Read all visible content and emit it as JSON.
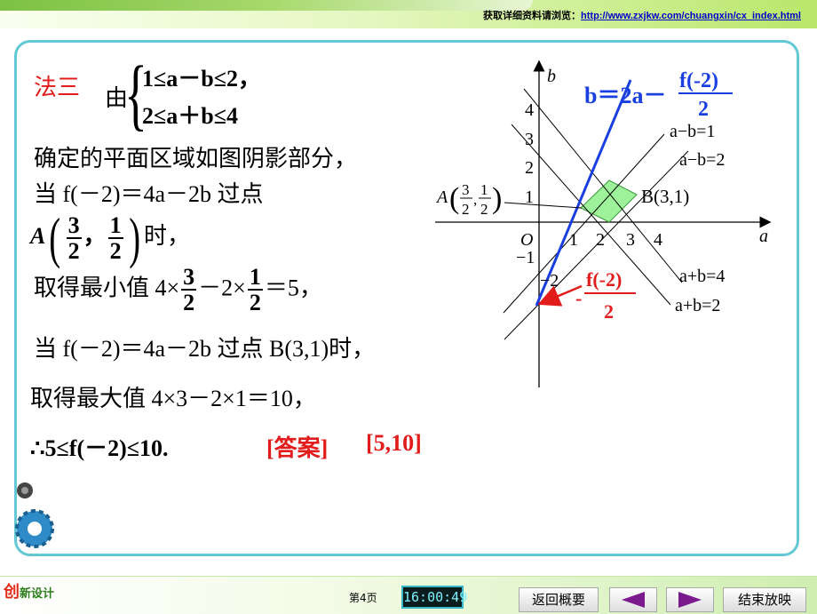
{
  "header": {
    "prefix": "获取详细资料请浏览：",
    "url": "http://www.zxjkw.com/chuangxin/cx_index.html"
  },
  "slide": {
    "method_label": "法三",
    "you": "由",
    "sys1": "1≤a－b≤2，",
    "sys2": "2≤a＋b≤4",
    "line_region": "确定的平面区域如图阴影部分，",
    "line_when1_pre": "当 f(－2)＝4a－2b 过点",
    "pointA_letter": "A",
    "pointA_num1": "3",
    "pointA_den1": "2",
    "pointA_sep": "，",
    "pointA_num2": "1",
    "pointA_den2": "2",
    "pointA_suffix": "时，",
    "line_min_pre": "取得最小值 4×",
    "min_f1_num": "3",
    "min_f1_den": "2",
    "line_min_mid": "－2×",
    "min_f2_num": "1",
    "min_f2_den": "2",
    "line_min_post": "＝5，",
    "line_when2": "当 f(－2)＝4a－2b 过点 B(3,1)时，",
    "line_max": "取得最大值 4×3－2×1＝10，",
    "line_conclusion": "∴5≤f(－2)≤10.",
    "answer_label": "[答案]",
    "answer_value": "[5,10]"
  },
  "graph": {
    "axis_a": "a",
    "axis_b": "b",
    "origin": "O",
    "x_ticks": [
      "1",
      "2",
      "3",
      "4"
    ],
    "y_ticks": [
      "1",
      "2",
      "3",
      "4",
      "−1",
      "−2"
    ],
    "line_labels": [
      "a−b=1",
      "a−b=2",
      "a+b=4",
      "a+b=2"
    ],
    "objective_left": "b＝2a－",
    "objective_num": "f(-2)",
    "objective_den": "2",
    "intercept_num": "f(-2)",
    "intercept_den": "2",
    "intercept_sign": "-",
    "point_A": "A",
    "point_A_num1": "3",
    "point_A_den1": "2",
    "point_A_num2": "1",
    "point_A_den2": "2",
    "point_B": "B(3,1)"
  },
  "footer": {
    "logo_main": "创",
    "logo_sub": "新设计",
    "page": "第4页",
    "clock": "16:00:49",
    "btn_back": "返回概要",
    "btn_end": "结束放映"
  },
  "colors": {
    "frame": "#61c8d4",
    "red": "#e21b1b",
    "blue": "#0033cc",
    "region": "#9ef29a"
  }
}
